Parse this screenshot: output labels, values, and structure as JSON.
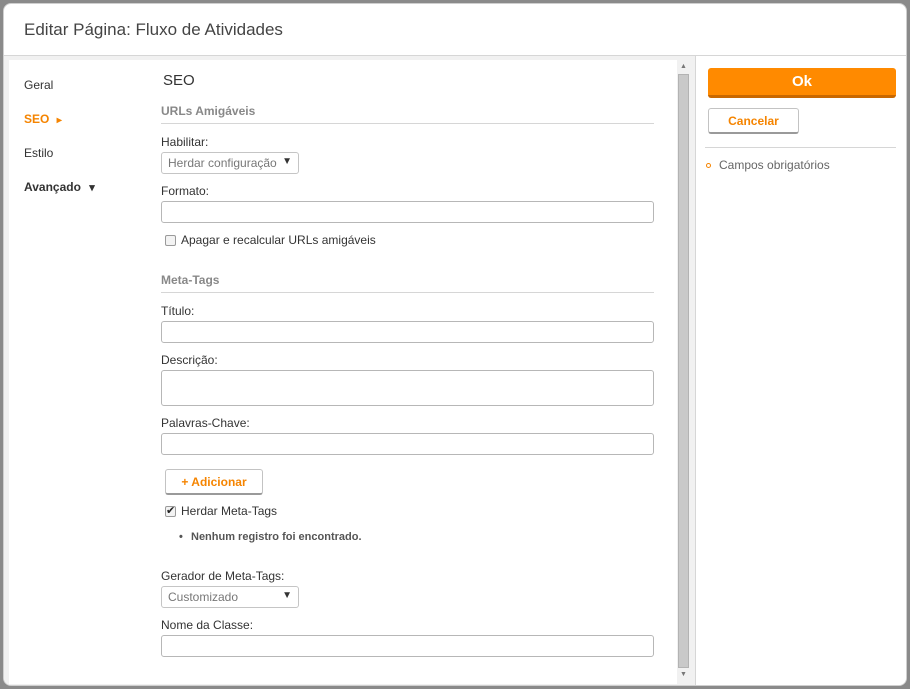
{
  "dialog": {
    "title": "Editar Página: Fluxo de Atividades"
  },
  "nav": {
    "items": [
      {
        "label": "Geral"
      },
      {
        "label": "SEO",
        "marker": "▸"
      },
      {
        "label": "Estilo"
      },
      {
        "label": "Avançado",
        "marker": "▾"
      }
    ]
  },
  "form": {
    "section_title": "SEO",
    "friendly_urls": {
      "title": "URLs Amigáveis",
      "enable_label": "Habilitar:",
      "enable_value": "Herdar configuração",
      "format_label": "Formato:",
      "format_value": "",
      "recalc_label": "Apagar e recalcular URLs amigáveis",
      "recalc_checked": false
    },
    "meta_tags": {
      "title": "Meta-Tags",
      "title_label": "Título:",
      "title_value": "",
      "description_label": "Descrição:",
      "description_value": "",
      "keywords_label": "Palavras-Chave:",
      "keywords_value": "",
      "add_button": "+ Adicionar",
      "inherit_label": "Herdar Meta-Tags",
      "inherit_checked": true,
      "empty_message": "Nenhum registro foi encontrado.",
      "generator_label": "Gerador de Meta-Tags:",
      "generator_value": "Customizado",
      "class_name_label": "Nome da Classe:",
      "class_name_value": ""
    }
  },
  "actions": {
    "ok_label": "Ok",
    "cancel_label": "Cancelar",
    "required_fields_label": "Campos obrigatórios"
  },
  "colors": {
    "accent": "#ff8a00",
    "accent_text": "#f58400"
  }
}
